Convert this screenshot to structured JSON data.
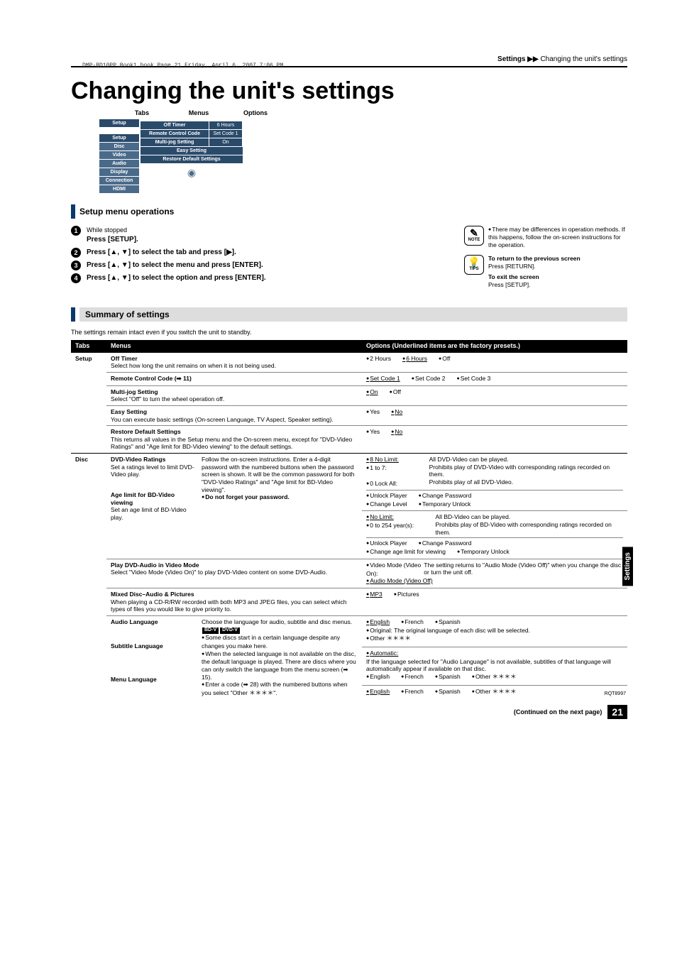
{
  "tiny_header": "DMP-BD10PP_Book1.book  Page 21  Friday, April 6, 2007  7:06 PM",
  "breadcrumb": {
    "section": "Settings",
    "arrows": "▶▶",
    "page": "Changing the unit's settings"
  },
  "title": "Changing the unit's settings",
  "ui_labels": {
    "tabs": "Tabs",
    "menus": "Menus",
    "options": "Options"
  },
  "sidebar": [
    "Setup",
    "",
    "Setup",
    "Disc",
    "Video",
    "Audio",
    "Display",
    "Connection",
    "HDMI"
  ],
  "mock_menus": [
    {
      "label": "Off Timer",
      "opt": "6 Hours"
    },
    {
      "label": "Remote Control Code",
      "opt": "Set Code 1"
    },
    {
      "label": "Multi-jog Setting",
      "opt": "On"
    },
    {
      "label": "Easy Setting"
    },
    {
      "label": "Restore Default Settings"
    }
  ],
  "section1_title": "Setup menu operations",
  "ops": [
    {
      "pre": "While stopped",
      "bold": "Press [SETUP]."
    },
    {
      "bold": "Press [▲, ▼] to select the tab and press [▶]."
    },
    {
      "bold": "Press [▲, ▼] to select the menu and press [ENTER]."
    },
    {
      "bold": "Press [▲, ▼] to select the option and press [ENTER]."
    }
  ],
  "note": {
    "label": "NOTE",
    "text": "There may be differences in operation methods. If this happens, follow the on-screen instructions for the operation."
  },
  "tips": {
    "label": "TIPS",
    "t1": "To return to the previous screen",
    "d1": "Press [RETURN].",
    "t2": "To exit the screen",
    "d2": "Press [SETUP]."
  },
  "section2_title": "Summary of settings",
  "summary_intro": "The settings remain intact even if you switch the unit to standby.",
  "thead": {
    "tabs": "Tabs",
    "menus": "Menus",
    "options": "Options (Underlined items are the factory presets.)"
  },
  "setup": {
    "tab": "Setup",
    "off_timer": {
      "title": "Off Timer",
      "desc": "Select how long the unit remains on when it is not being used.",
      "opts": [
        "2 Hours",
        "6 Hours",
        "Off"
      ],
      "preset": 1
    },
    "rcc": {
      "title": "Remote Control Code (➡ 11)",
      "opts": [
        "Set Code 1",
        "Set Code 2",
        "Set Code 3"
      ],
      "preset": 0
    },
    "multijog": {
      "title": "Multi-jog Setting",
      "desc": "Select \"Off\" to turn the wheel operation off.",
      "opts": [
        "On",
        "Off"
      ],
      "preset": 0
    },
    "easy": {
      "title": "Easy Setting",
      "desc": "You can execute basic settings (On-screen Language, TV Aspect, Speaker setting).",
      "opts": [
        "Yes",
        "No"
      ],
      "preset": 1
    },
    "restore": {
      "title": "Restore Default Settings",
      "desc": "This returns all values in the Setup menu and the On-screen menu, except for \"DVD-Video Ratings\" and \"Age limit for BD-Video viewing\" to the default settings.",
      "opts": [
        "Yes",
        "No"
      ],
      "preset": 1
    }
  },
  "disc": {
    "tab": "Disc",
    "dvd_ratings": {
      "title": "DVD-Video Ratings",
      "left": "Set a ratings level to limit DVD-Video play.",
      "right": "Follow the on-screen instructions. Enter a 4-digit password with the numbered buttons when the password screen is shown. It will be the common password for both \"DVD-Video Ratings\" and \"Age limit for BD-Video viewing\".",
      "line1a": "8 No Limit:",
      "line1b": "All DVD-Video can be played.",
      "line2a": "1 to 7:",
      "line2b": "Prohibits play of DVD-Video with corresponding ratings recorded on them.",
      "line3a": "0 Lock All:",
      "line3b": "Prohibits play of all DVD-Video.",
      "sub": [
        "Unlock Player",
        "Change Level",
        "Change Password",
        "Temporary Unlock"
      ]
    },
    "age_limit": {
      "title": "Age limit for BD-Video viewing",
      "left": "Set an age limit of BD-Video play.",
      "right_bold": "Do not forget your password.",
      "line1a": "No Limit:",
      "line1b": "All BD-Video can be played.",
      "line2a": "0 to 254 year(s):",
      "line2b": "Prohibits play of BD-Video with corresponding ratings recorded on them.",
      "sub": [
        "Unlock Player",
        "Change age limit for viewing",
        "Change Password",
        "Temporary Unlock"
      ]
    },
    "play_dvda": {
      "title": "Play DVD-Audio in Video Mode",
      "desc": "Select \"Video Mode (Video On)\" to play DVD-Video content on some DVD-Audio.",
      "o1": "Video Mode (Video On):",
      "o1d": "The setting returns to \"Audio Mode (Video Off)\" when you change the disc or turn the unit off.",
      "o2": "Audio Mode (Video Off)"
    },
    "mixed": {
      "title": "Mixed Disc–Audio & Pictures",
      "desc": "When playing a CD-R/RW recorded with both MP3 and JPEG files, you can select which types of files you would like to give priority to.",
      "opts": [
        "MP3",
        "Pictures"
      ],
      "preset": 0
    },
    "audio_lang": {
      "title": "Audio Language",
      "right1": "Choose the language for audio, subtitle and disc menus.",
      "badges": [
        "BD-V",
        "DVD-V"
      ],
      "right2": "Some discs start in a certain language despite any changes you make here.",
      "right3": "When the selected language is not available on the disc, the default language is played. There are discs where you can only switch the language from the menu screen (➡ 15).",
      "right4": "Enter a code (➡ 28) with the numbered buttons when you select \"Other ＊＊＊＊\".",
      "opts": [
        "English",
        "French",
        "Spanish"
      ],
      "orig": "Original: The original language of each disc will be selected.",
      "other": "Other ＊＊＊＊"
    },
    "subtitle_lang": {
      "title": "Subtitle Language",
      "auto": "Automatic:",
      "auto_d": "If the language selected for \"Audio Language\" is not available, subtitles of that language will automatically appear if available on that disc.",
      "opts": [
        "English",
        "French",
        "Spanish",
        "Other ＊＊＊＊"
      ]
    },
    "menu_lang": {
      "title": "Menu Language",
      "opts": [
        "English",
        "French",
        "Spanish",
        "Other ＊＊＊＊"
      ],
      "preset": 0
    }
  },
  "footer": {
    "cont": "(Continued on the next page)",
    "page": "21",
    "rqt": "RQT8997"
  },
  "side_tab": "Settings"
}
